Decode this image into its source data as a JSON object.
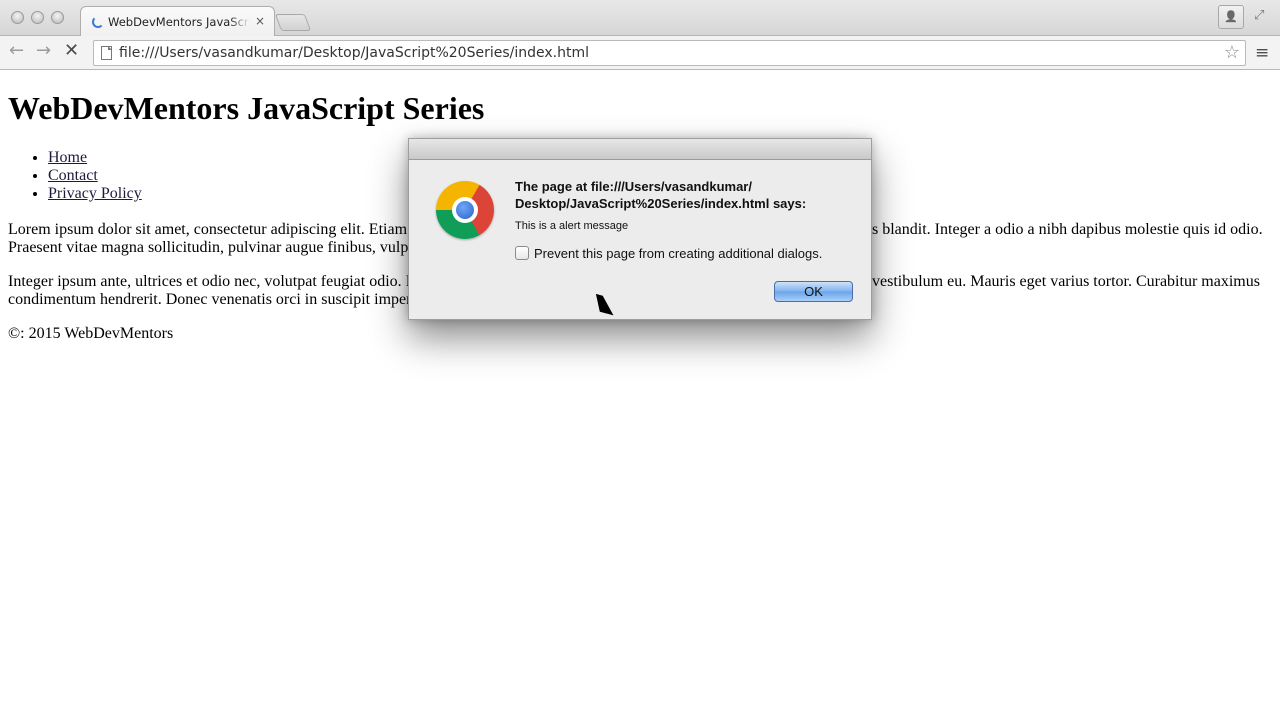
{
  "browser": {
    "tab": {
      "title": "WebDevMentors JavaScript Series",
      "close": "×"
    },
    "toolbar": {
      "back": "←",
      "forward": "→",
      "stop": "✕",
      "url": "file:///Users/vasandkumar/Desktop/JavaScript%20Series/index.html",
      "star": "☆",
      "menu": "≡"
    },
    "profile_icon": "👤",
    "fullscreen_icon": "⤢"
  },
  "page": {
    "heading": "WebDevMentors JavaScript Series",
    "nav": [
      "Home",
      "Contact",
      "Privacy Policy"
    ],
    "paragraph1": "Lorem ipsum dolor sit amet, consectetur adipiscing elit. Etiam                                                                                         s blandit. Integer a odio a nibh dapibus molestie quis id odio. Praesent vitae magna sollicitudin, pulvinar augue finibus, vulp",
    "paragraph1_left_line1": "Lorem ipsum dolor sit amet, consectetur adipiscing elit. Etiam",
    "paragraph1_right_line1": "s blandit. Integer a odio a nibh dapibus molestie quis id odio.",
    "paragraph1_left_line2": "Praesent vitae magna sollicitudin, pulvinar augue finibus, vulp",
    "paragraph2_left_line1": "Integer ipsum ante, ultrices et odio nec, volutpat feugiat odio. I",
    "paragraph2_right_line1": "vestibulum eu. Mauris eget varius tortor. Curabitur maximus",
    "paragraph2_left_line2": "condimentum hendrerit. Donec venenatis orci in suscipit imper",
    "footer": "©: 2015 WebDevMentors"
  },
  "dialog": {
    "heading": "The page at file:///Users/vasandkumar/ Desktop/JavaScript%20Series/index.html says:",
    "heading_line1": "The page at file:///Users/vasandkumar/",
    "heading_line2": "Desktop/JavaScript%20Series/index.html says:",
    "message": "This is a alert message",
    "checkbox_label": "Prevent this page from creating additional dialogs.",
    "checkbox_checked": false,
    "ok_label": "OK",
    "icon": "chrome-logo-icon"
  }
}
